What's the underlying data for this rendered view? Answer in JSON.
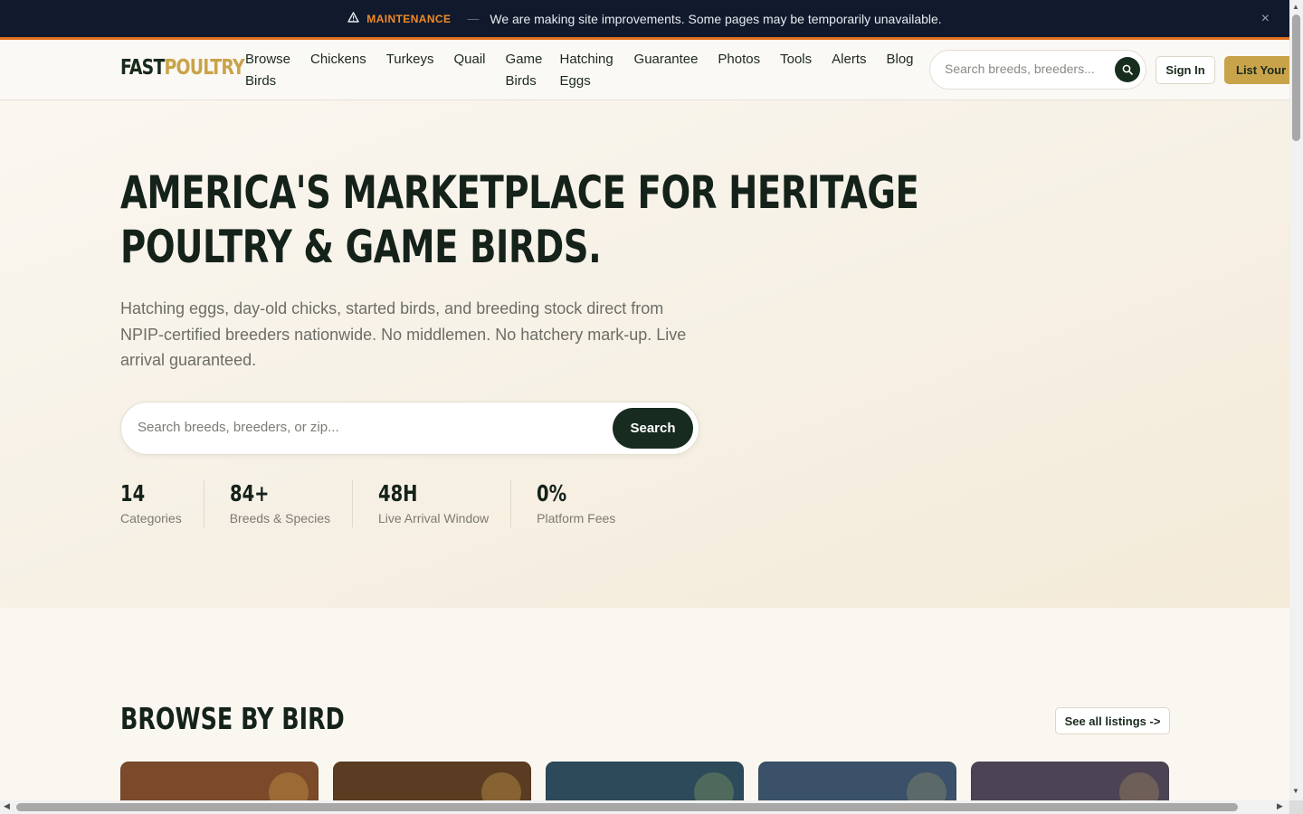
{
  "maintenance": {
    "icon": "warning-icon",
    "tag": "MAINTENANCE",
    "separator": "—",
    "message": "We are making site improvements. Some pages may be temporarily unavailable.",
    "close_icon": "close-icon",
    "close_glyph": "×"
  },
  "header": {
    "logo_part1": "FAST",
    "logo_part2": "POULTRY",
    "nav": [
      {
        "line1": "Browse",
        "line2": "Birds"
      },
      {
        "line1": "Chickens",
        "line2": ""
      },
      {
        "line1": "Turkeys",
        "line2": ""
      },
      {
        "line1": "Quail",
        "line2": ""
      },
      {
        "line1": "Game",
        "line2": "Birds"
      },
      {
        "line1": "Hatching",
        "line2": "Eggs"
      },
      {
        "line1": "Guarantee",
        "line2": ""
      },
      {
        "line1": "Photos",
        "line2": ""
      },
      {
        "line1": "Tools",
        "line2": ""
      },
      {
        "line1": "Alerts",
        "line2": ""
      },
      {
        "line1": "Blog",
        "line2": ""
      }
    ],
    "search_placeholder": "Search breeds, breeders...",
    "search_icon": "search-icon",
    "signin_label": "Sign In",
    "list_label": "List Your Birds"
  },
  "hero": {
    "title_line1": "AMERICA'S MARKETPLACE FOR HERITAGE",
    "title_line2": "POULTRY & GAME BIRDS.",
    "subtitle": "Hatching eggs, day-old chicks, started birds, and breeding stock direct from NPIP-certified breeders nationwide. No middlemen. No hatchery mark-up. Live arrival guaranteed.",
    "search_placeholder": "Search breeds, breeders, or zip...",
    "search_button": "Search",
    "stats": [
      {
        "value": "14",
        "label": "Categories"
      },
      {
        "value": "84+",
        "label": "Breeds & Species"
      },
      {
        "value": "48H",
        "label": "Live Arrival Window"
      },
      {
        "value": "0%",
        "label": "Platform Fees"
      }
    ]
  },
  "browse": {
    "title": "BROWSE BY BIRD",
    "see_all": "See all listings ->",
    "cards": [
      {
        "color": "#7a4a2a",
        "accent": "#9b6a35"
      },
      {
        "color": "#5a3c22",
        "accent": "#876232"
      },
      {
        "color": "#2c4a59",
        "accent": "#4f6a5c"
      },
      {
        "color": "#3b5069",
        "accent": "#5b6a68"
      },
      {
        "color": "#4c4454",
        "accent": "#6e5f58"
      }
    ]
  },
  "colors": {
    "navy_bar": "#101a2c",
    "maintenance_orange": "#f08a2a",
    "brand_green": "#172b1e",
    "brand_gold": "#c9a34a",
    "background": "#faf7f1"
  }
}
